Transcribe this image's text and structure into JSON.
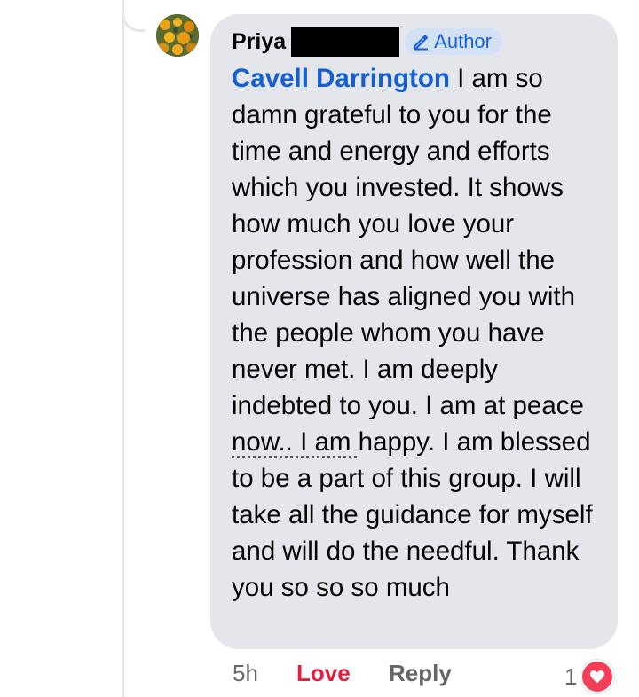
{
  "comment": {
    "author_name": "Priya",
    "author_badge": "Author",
    "mention": "Cavell Darrington",
    "text_part1": " I am so damn grateful to you for the time and energy and efforts which you invested. It shows how much you love your profession and how well the universe has aligned you with the people whom you have never met. I am deeply indebted to you. I am at peace",
    "text_underlined": " now.. I am ",
    "text_part2": "happy. I am blessed to be a part of this group. I will take all the guidance for myself and will do the needful. Thank you so so so much"
  },
  "actions": {
    "time": "5h",
    "love_label": "Love",
    "reply_label": "Reply",
    "reaction_count": "1"
  },
  "colors": {
    "bubble_bg": "#e4e6eb",
    "mention": "#1460d1",
    "love": "#e41e3f",
    "badge_bg": "#d3e1f7"
  },
  "icons": {
    "badge": "pencil-icon",
    "reaction": "heart-icon"
  }
}
